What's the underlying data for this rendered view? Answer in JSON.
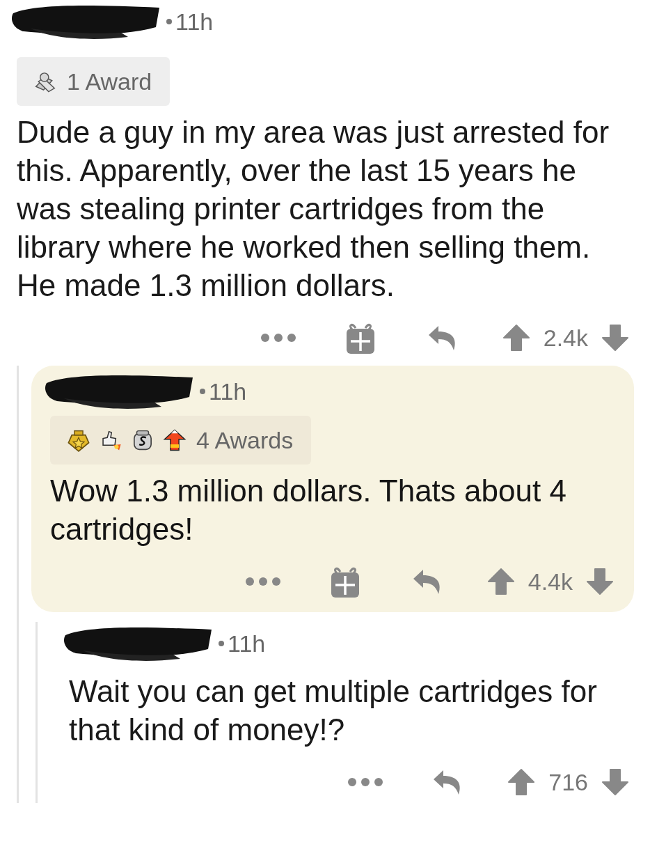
{
  "comments": [
    {
      "time": "11h",
      "highlighted": false,
      "gift": true,
      "awards": {
        "label": "1 Award",
        "icons": [
          {
            "kind": "handshake"
          }
        ]
      },
      "body": "Dude a guy in my area was just arrested for this. Apparently, over the last 15 years he was stealing printer cartridges from the library where he worked then selling them. He made 1.3 million dollars.",
      "score": "2.4k",
      "children": [
        {
          "time": "11h",
          "highlighted": true,
          "gift": true,
          "awards": {
            "label": "4 Awards",
            "icons": [
              {
                "kind": "medal"
              },
              {
                "kind": "rocket-thumb"
              },
              {
                "kind": "silver"
              },
              {
                "kind": "candy-arrow"
              }
            ]
          },
          "body": "Wow 1.3 million dollars. Thats about 4 cartridges!",
          "score": "4.4k",
          "children": [
            {
              "time": "11h",
              "highlighted": false,
              "gift": false,
              "body": "Wait you can get multiple cartridges for that kind of money!?",
              "score": "716"
            }
          ]
        }
      ]
    }
  ]
}
